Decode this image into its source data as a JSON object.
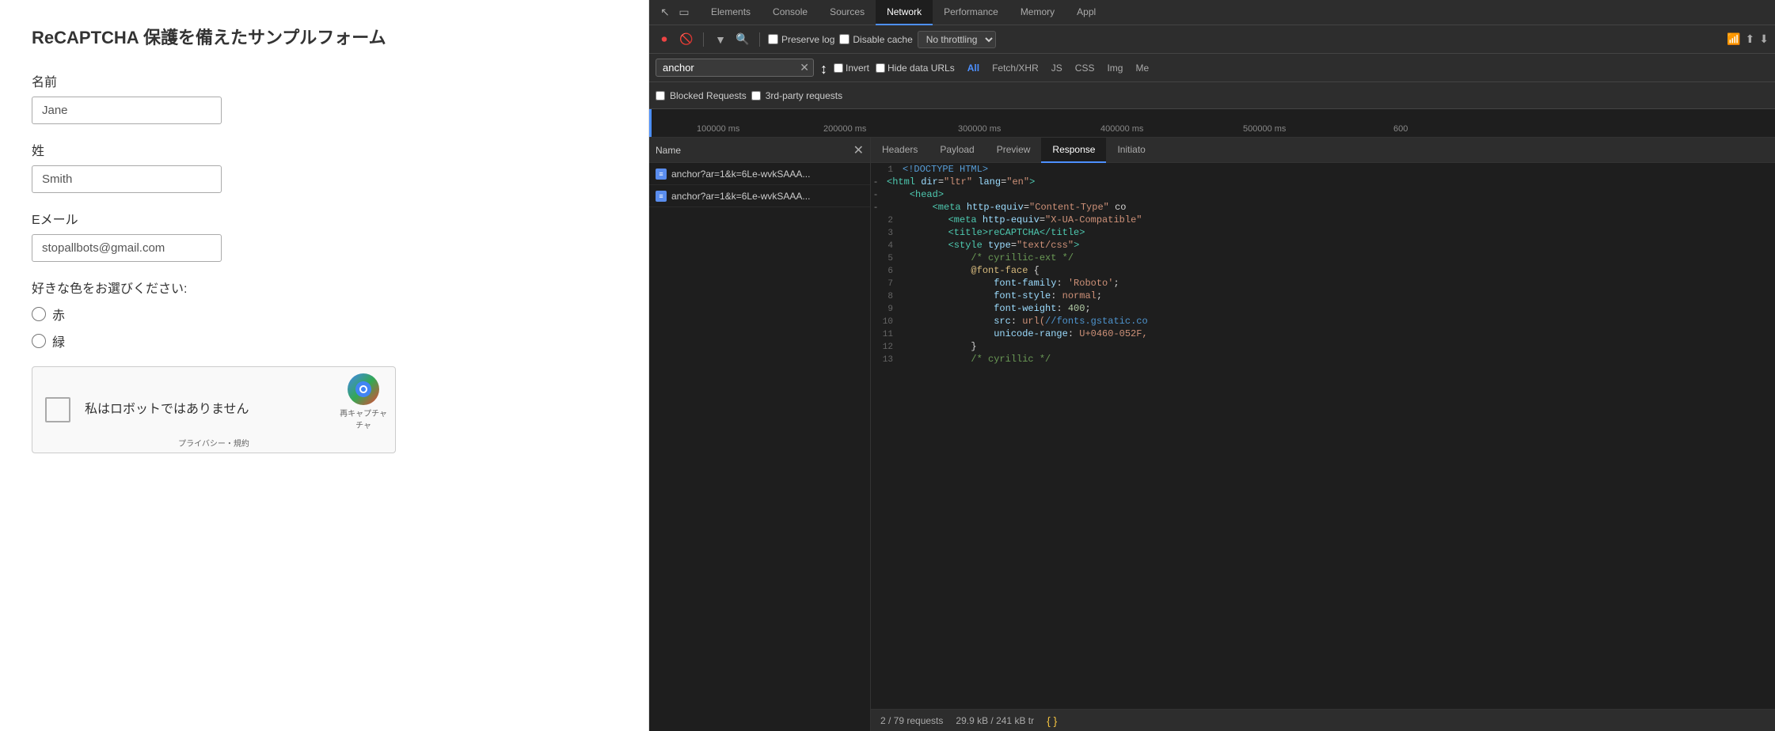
{
  "form": {
    "title": "ReCAPTCHA 保護を備えたサンプルフォーム",
    "fields": [
      {
        "label": "名前",
        "placeholder": "Jane",
        "value": "Jane"
      },
      {
        "label": "姓",
        "placeholder": "Smith",
        "value": "Smith"
      },
      {
        "label": "Eメール",
        "placeholder": "stopallbots@gmail.com",
        "value": "stopallbots@gmail.com"
      }
    ],
    "color_label": "好きな色をお選びください:",
    "colors": [
      "赤",
      "緑"
    ],
    "recaptcha_text": "私はロボットではありません",
    "recaptcha_refresh": "再キャプチャ",
    "recaptcha_privacy": "プライバシー・規約"
  },
  "devtools": {
    "tabs": [
      "Elements",
      "Console",
      "Sources",
      "Network",
      "Performance",
      "Memory",
      "Appl"
    ],
    "active_tab": "Network",
    "toolbar": {
      "preserve_log_label": "Preserve log",
      "disable_cache_label": "Disable cache",
      "throttling_label": "No throttling",
      "throttling_arrow": "▼"
    },
    "filter": {
      "value": "anchor",
      "invert_label": "Invert",
      "hide_data_label": "Hide data URLs",
      "type_buttons": [
        "All",
        "Fetch/XHR",
        "JS",
        "CSS",
        "Img",
        "Me"
      ],
      "active_type": "All"
    },
    "blocked": {
      "blocked_label": "Blocked Requests",
      "third_party_label": "3rd-party requests"
    },
    "timeline": {
      "labels": [
        "100000 ms",
        "200000 ms",
        "300000 ms",
        "400000 ms",
        "500000 ms",
        "600"
      ]
    },
    "network_list": {
      "header": "Name",
      "items": [
        {
          "name": "anchor?ar=1&k=6Le-wvkSAAA...",
          "icon": "doc"
        },
        {
          "name": "anchor?ar=1&k=6Le-wvkSAAA...",
          "icon": "doc"
        }
      ]
    },
    "response_tabs": [
      "Headers",
      "Payload",
      "Preview",
      "Response",
      "Initiato"
    ],
    "active_response_tab": "Response",
    "code_lines": [
      {
        "num": "1",
        "dash": "",
        "content": "<!DOCTYPE HTML>",
        "type": "keyword"
      },
      {
        "num": "",
        "dash": "-",
        "content": "<html dir=\"ltr\" lang=\"en\">",
        "type": "tag"
      },
      {
        "num": "",
        "dash": "-",
        "content": "    <head>",
        "type": "tag"
      },
      {
        "num": "",
        "dash": "-",
        "content": "        <meta http-equiv=\"Content-Type\" co",
        "type": "mixed"
      },
      {
        "num": "2",
        "dash": "",
        "content": "        <meta http-equiv=\"X-UA-Compatible\"",
        "type": "mixed"
      },
      {
        "num": "3",
        "dash": "",
        "content": "        <title>reCAPTCHA</title>",
        "type": "mixed"
      },
      {
        "num": "4",
        "dash": "",
        "content": "        <style type=\"text/css\">",
        "type": "mixed"
      },
      {
        "num": "5",
        "dash": "",
        "content": "            /* cyrillic-ext */",
        "type": "comment"
      },
      {
        "num": "6",
        "dash": "",
        "content": "            @font-face {",
        "type": "atrule"
      },
      {
        "num": "7",
        "dash": "",
        "content": "                font-family: 'Roboto';",
        "type": "prop"
      },
      {
        "num": "8",
        "dash": "",
        "content": "                font-style: normal;",
        "type": "prop"
      },
      {
        "num": "9",
        "dash": "",
        "content": "                font-weight: 400;",
        "type": "prop"
      },
      {
        "num": "10",
        "dash": "",
        "content": "                src: url(//fonts.gstatic.co",
        "type": "prop"
      },
      {
        "num": "11",
        "dash": "",
        "content": "                unicode-range: U+0460-052F,",
        "type": "prop"
      },
      {
        "num": "12",
        "dash": "",
        "content": "            }",
        "type": "brace"
      },
      {
        "num": "13",
        "dash": "",
        "content": "            /* cyrillic */",
        "type": "comment"
      }
    ],
    "status_bar": {
      "requests": "2 / 79 requests",
      "size": "29.9 kB / 241 kB tr"
    }
  }
}
